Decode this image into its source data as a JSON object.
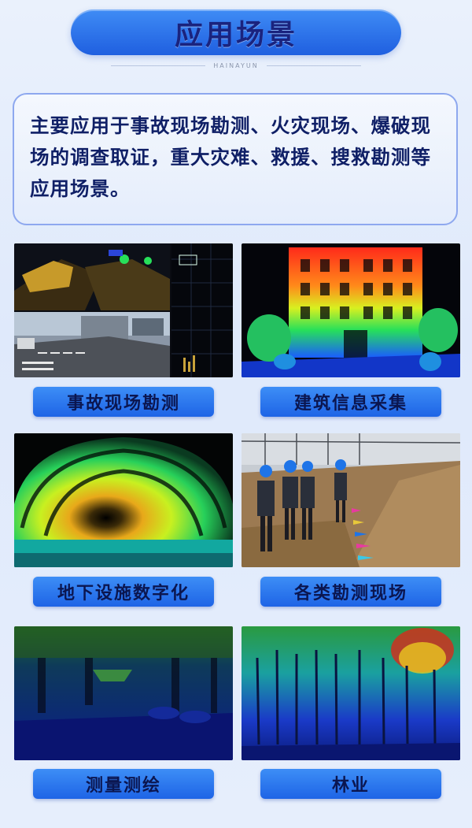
{
  "header": {
    "title": "应用场景",
    "brand": "HAINAYUN"
  },
  "intro": {
    "text": "主要应用于事故现场勘测、火灾现场、爆破现场的调查取证，重大灾难、救援、搜救勘测等应用场景。"
  },
  "scenes": [
    {
      "label": "事故现场勘测",
      "image": "road-scan-monitor"
    },
    {
      "label": "建筑信息采集",
      "image": "building-point-cloud"
    },
    {
      "label": "地下设施数字化",
      "image": "tunnel-point-cloud"
    },
    {
      "label": "各类勘测现场",
      "image": "field-survey-workers"
    },
    {
      "label": "测量测绘",
      "image": "parking-garage-scan"
    },
    {
      "label": "林业",
      "image": "forest-point-cloud"
    }
  ]
}
